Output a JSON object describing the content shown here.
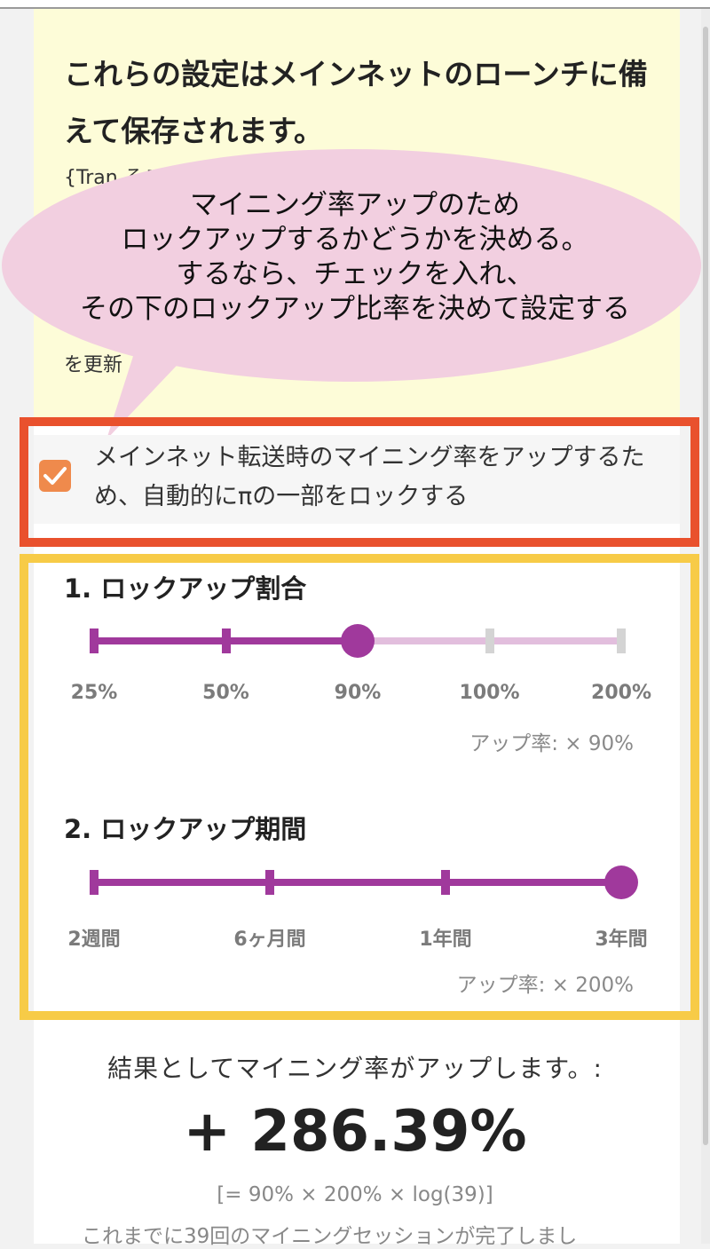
{
  "info": {
    "title": "これらの設定はメインネットのローンチに備えて保存されます。",
    "body_visible": "{Tran                                                    ることと",
    "update_visible": "を更新"
  },
  "bubble": {
    "text": "マイニング率アップのため\nロックアップするかどうかを決める。\nするなら、チェックを入れ、\nその下のロックアップ比率を決めて設定する"
  },
  "lockup_checkbox": {
    "checked": true,
    "label": "メインネット転送時のマイニング率をアップするため、自動的にπの一部をロックする"
  },
  "lockup_ratio": {
    "title": "1. ロックアップ割合",
    "options": [
      "25%",
      "50%",
      "90%",
      "100%",
      "200%"
    ],
    "selected_index": 2,
    "rate_text": "アップ率: × 90%"
  },
  "lockup_period": {
    "title": "2. ロックアップ期間",
    "options": [
      "2週間",
      "6ヶ月間",
      "1年間",
      "3年間"
    ],
    "selected_index": 3,
    "rate_text": "アップ率: × 200%"
  },
  "result": {
    "intro": "結果としてマイニング率がアップします。:",
    "value": "+ 286.39%",
    "formula": "[= 90% × 200% × log(39)]",
    "sessions": "これまでに39回のマイニングセッションが完了しまし"
  },
  "colors": {
    "accent_purple": "#a0399c",
    "inactive_track": "#e2bedd",
    "inactive_tick": "#d4d4d4",
    "checkbox_orange": "#ef8a4c",
    "highlight_red": "#e9512d",
    "highlight_yellow": "#f7cb47",
    "bubble_pink": "#f2cfe0",
    "info_yellow": "#fdfcd8"
  }
}
